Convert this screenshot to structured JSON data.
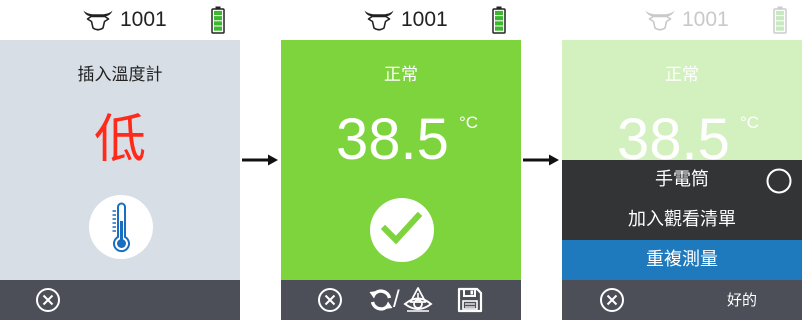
{
  "colors": {
    "panel_gray": "#d7dee6",
    "panel_green": "#7ed43c",
    "panel_green_light": "#d3f0bf",
    "bottom_bar": "#4c4e58",
    "menu_dark": "#333436",
    "menu_highlight": "#1f79bd",
    "reading_low": "#ff2a1a",
    "thermometer_blue": "#1a6ec0",
    "battery_green": "#3cb82e"
  },
  "flow_arrow_icon": "arrow-right-icon",
  "screen1": {
    "status_bar": {
      "icon": "cow-head-icon",
      "device_id": "1001",
      "battery_level": 1.0
    },
    "prompt": "插入溫度計",
    "reading": "低",
    "badge_icon": "thermometer-icon",
    "bottom_bar": {
      "close_icon": "close-circle-icon"
    }
  },
  "screen2": {
    "status_bar": {
      "icon": "cow-head-icon",
      "device_id": "1001",
      "battery_level": 1.0
    },
    "status": "正常",
    "temperature": "38.5",
    "unit": "°C",
    "badge_icon": "checkmark-icon",
    "bottom_bar": {
      "close_icon": "close-circle-icon",
      "remeasure_icon": "refresh-icon",
      "separator": "/",
      "hide_icon": "eye-warning-icon",
      "save_icon": "save-icon"
    }
  },
  "screen3": {
    "status_bar": {
      "icon": "cow-head-icon",
      "device_id": "1001",
      "battery_level": 1.0
    },
    "status": "正常",
    "temperature": "38.5",
    "unit": "°C",
    "menu": [
      {
        "label": "手電筒",
        "toggle_on": false
      },
      {
        "label": "加入觀看清單"
      },
      {
        "label": "重複測量",
        "selected": true
      }
    ],
    "bottom_bar": {
      "close_icon": "close-circle-icon",
      "ok_label": "好的"
    }
  }
}
